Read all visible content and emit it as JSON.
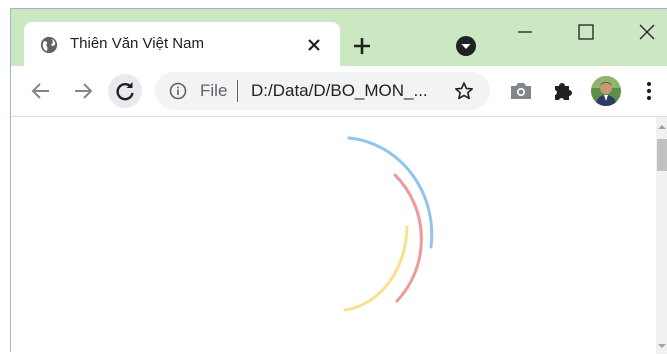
{
  "tab": {
    "title": "Thiên Văn Việt Nam",
    "favicon": "globe-icon",
    "close_icon": "close-icon"
  },
  "titlebar": {
    "new_tab_icon": "plus-icon",
    "tab_search_icon": "tab-search-icon",
    "minimize_icon": "minimize-icon",
    "maximize_icon": "maximize-icon",
    "close_icon": "close-icon"
  },
  "toolbar": {
    "back_icon": "arrow-left-icon",
    "forward_icon": "arrow-right-icon",
    "reload_icon": "reload-icon",
    "omnibox": {
      "info_icon": "info-icon",
      "scheme_label": "File",
      "url": "D:/Data/D/BO_MON_...",
      "star_icon": "star-icon"
    },
    "camera_icon": "camera-icon",
    "extensions_icon": "puzzle-icon",
    "avatar": "avatar",
    "menu_icon": "kebab-menu-icon"
  },
  "colors": {
    "frame": "#cce8c3",
    "spinner_blue": "#8ec6ec",
    "spinner_red": "#ef9a9a",
    "spinner_yellow": "#fbe08a"
  }
}
